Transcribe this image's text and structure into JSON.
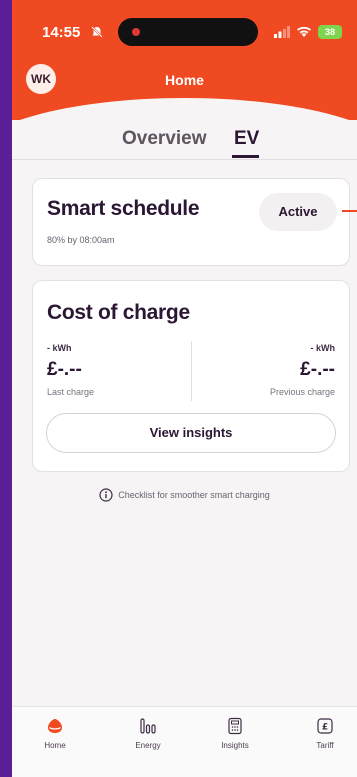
{
  "status_bar": {
    "time": "14:55",
    "battery": "38"
  },
  "header": {
    "avatar_initials": "WK",
    "title": "Home"
  },
  "tabs": [
    {
      "label": "Overview",
      "selected": false
    },
    {
      "label": "EV",
      "selected": true
    }
  ],
  "smart_schedule": {
    "title": "Smart schedule",
    "subtitle": "80% by 08:00am",
    "status": "Active"
  },
  "cost_of_charge": {
    "title": "Cost of charge",
    "last": {
      "unit": "- kWh",
      "value": "£-.--",
      "label": "Last charge"
    },
    "previous": {
      "unit": "- kWh",
      "value": "£-.--",
      "label": "Previous charge"
    },
    "button_label": "View insights"
  },
  "checklist": {
    "icon": "info-icon",
    "text": "Checklist for smoother smart charging"
  },
  "bottom_nav": [
    {
      "label": "Home",
      "icon": "home-icon",
      "active": true
    },
    {
      "label": "Energy",
      "icon": "energy-bars-icon",
      "active": false
    },
    {
      "label": "Insights",
      "icon": "calculator-icon",
      "active": false
    },
    {
      "label": "Tariff",
      "icon": "pound-tag-icon",
      "active": false
    }
  ],
  "colors": {
    "brand": "#f04a23",
    "text_dark": "#2b1733",
    "background": "#f6f4f5",
    "frame": "#5a1e96"
  }
}
